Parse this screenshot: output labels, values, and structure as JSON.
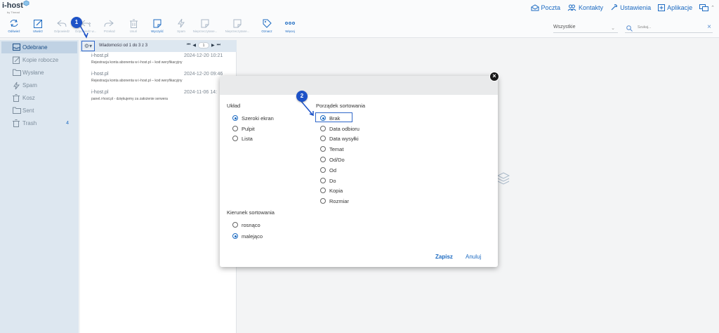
{
  "app": {
    "logo_text": "i-host",
    "logo_sub": "by Thread"
  },
  "topnav": [
    {
      "label": "Poczta",
      "icon": "mail-icon"
    },
    {
      "label": "Kontakty",
      "icon": "contacts-icon"
    },
    {
      "label": "Ustawienia",
      "icon": "settings-icon"
    },
    {
      "label": "Aplikacje",
      "icon": "apps-icon"
    }
  ],
  "toolbar": {
    "buttons": [
      {
        "label": "Odśwież",
        "icon": "refresh-icon",
        "enabled": true
      },
      {
        "label": "Utwórz",
        "icon": "compose-icon",
        "enabled": true
      },
      {
        "label": "Odpowiedz",
        "icon": "reply-icon",
        "enabled": false
      },
      {
        "label": "Odpowiedz w...",
        "icon": "reply-all-icon",
        "enabled": false
      },
      {
        "label": "Przekaż",
        "icon": "forward-icon",
        "enabled": false
      },
      {
        "label": "Usuń",
        "icon": "delete-icon",
        "enabled": false
      },
      {
        "label": "Wyczyść",
        "icon": "clear-icon",
        "enabled": true
      },
      {
        "label": "Spam",
        "icon": "spam-icon",
        "enabled": false
      },
      {
        "label": "Nieprzeczytane...",
        "icon": "unread-icon",
        "enabled": false
      },
      {
        "label": "Nieprzeczytane...",
        "icon": "mark-icon",
        "enabled": false
      },
      {
        "label": "Oznacz",
        "icon": "tag-icon",
        "enabled": true
      },
      {
        "label": "Więcej",
        "icon": "more-icon",
        "enabled": true
      }
    ],
    "filter_value": "Wszystkie",
    "search_placeholder": "Szukaj..."
  },
  "sidebar": {
    "folders": [
      {
        "name": "Odebrane",
        "icon": "inbox-icon",
        "active": true,
        "count": ""
      },
      {
        "name": "Kopie robocze",
        "icon": "draft-icon",
        "active": false,
        "count": ""
      },
      {
        "name": "Wysłane",
        "icon": "sent-icon",
        "active": false,
        "count": ""
      },
      {
        "name": "Spam",
        "icon": "spam-icon",
        "active": false,
        "count": ""
      },
      {
        "name": "Kosz",
        "icon": "trash-icon",
        "active": false,
        "count": ""
      },
      {
        "name": "Sent",
        "icon": "folder-icon",
        "active": false,
        "count": ""
      },
      {
        "name": "Trash",
        "icon": "trash-icon",
        "active": false,
        "count": "4"
      }
    ]
  },
  "list": {
    "count_text": "Wiadomości od 1 do 3 z 3",
    "page": "1",
    "messages": [
      {
        "from": "i-host.pl",
        "date": "2024-12-20 10:21",
        "subject": "Rejestracja konta abonenta w i-host.pl – kod weryfikacyjny"
      },
      {
        "from": "i-host.pl",
        "date": "2024-12-20 09:46",
        "subject": "Rejestracja konta abonenta w i-host.pl – kod weryfikacyjny"
      },
      {
        "from": "i-host.pl",
        "date": "2024-11-06 14:",
        "subject": "panel.i-host.pl - dziękujemy za założenie serwera"
      }
    ]
  },
  "dialog": {
    "layout_title": "Układ",
    "layout_options": [
      {
        "label": "Szeroki ekran",
        "checked": true
      },
      {
        "label": "Pulpit",
        "checked": false
      },
      {
        "label": "Lista",
        "checked": false
      }
    ],
    "sort_title": "Porządek sortowania",
    "sort_options": [
      {
        "label": "Brak",
        "checked": true
      },
      {
        "label": "Data odbioru",
        "checked": false
      },
      {
        "label": "Data wysyłki",
        "checked": false
      },
      {
        "label": "Temat",
        "checked": false
      },
      {
        "label": "Od/Do",
        "checked": false
      },
      {
        "label": "Od",
        "checked": false
      },
      {
        "label": "Do",
        "checked": false
      },
      {
        "label": "Kopia",
        "checked": false
      },
      {
        "label": "Rozmiar",
        "checked": false
      }
    ],
    "direction_title": "Kierunek sortowania",
    "direction_options": [
      {
        "label": "rosnąco",
        "checked": false
      },
      {
        "label": "malejąco",
        "checked": true
      }
    ],
    "save_label": "Zapisz",
    "cancel_label": "Anuluj",
    "close_label": "×"
  },
  "annotations": {
    "step1": "1",
    "step2": "2"
  },
  "colors": {
    "accent": "#1d6bc2",
    "sidebar_bg": "#dde7f0",
    "active_folder": "#c0d2e4",
    "badge": "#1d52c7"
  }
}
